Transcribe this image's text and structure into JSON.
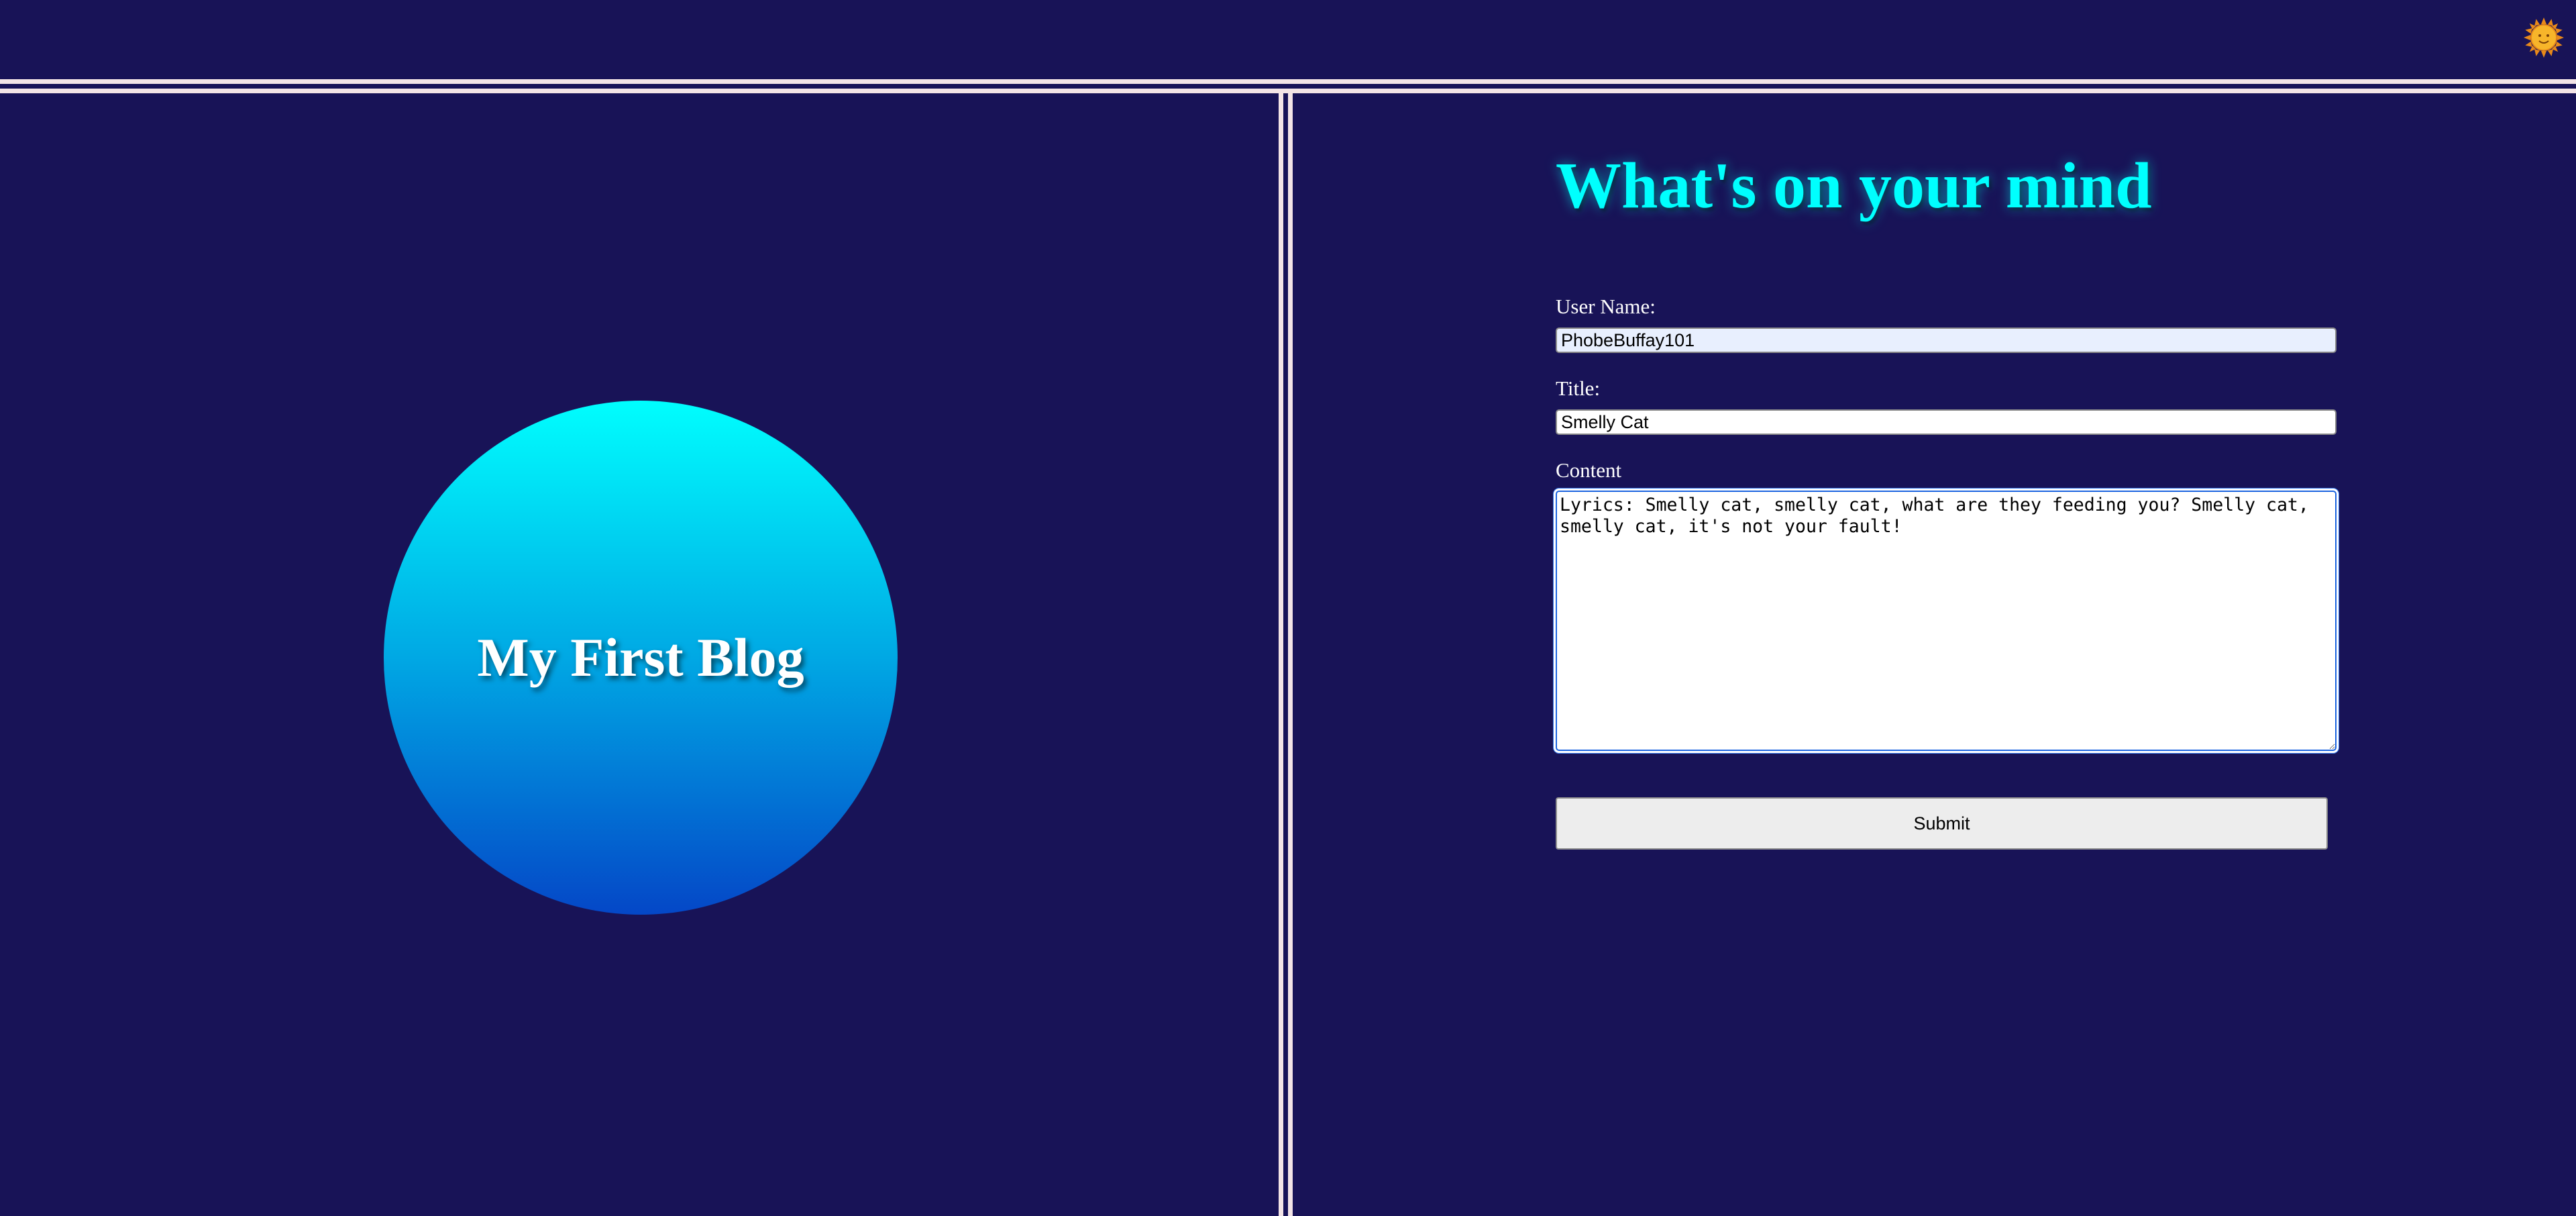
{
  "header": {
    "theme_icon": "sun-icon"
  },
  "left": {
    "blog_title": "My First Blog"
  },
  "form": {
    "heading": "What's on your mind",
    "user_name_label": "User Name:",
    "user_name_value": "PhobeBuffay101",
    "title_label": "Title:",
    "title_value": "Smelly Cat",
    "content_label": "Content",
    "content_value": "Lyrics: Smelly cat, smelly cat, what are they feeding you? Smelly cat, smelly cat, it's not your fault!",
    "submit_label": "Submit"
  },
  "colors": {
    "background": "#181357",
    "divider": "#f3e4e6",
    "heading": "#00fffe",
    "circle_top": "#00fefe",
    "circle_bottom": "#0447c7"
  }
}
